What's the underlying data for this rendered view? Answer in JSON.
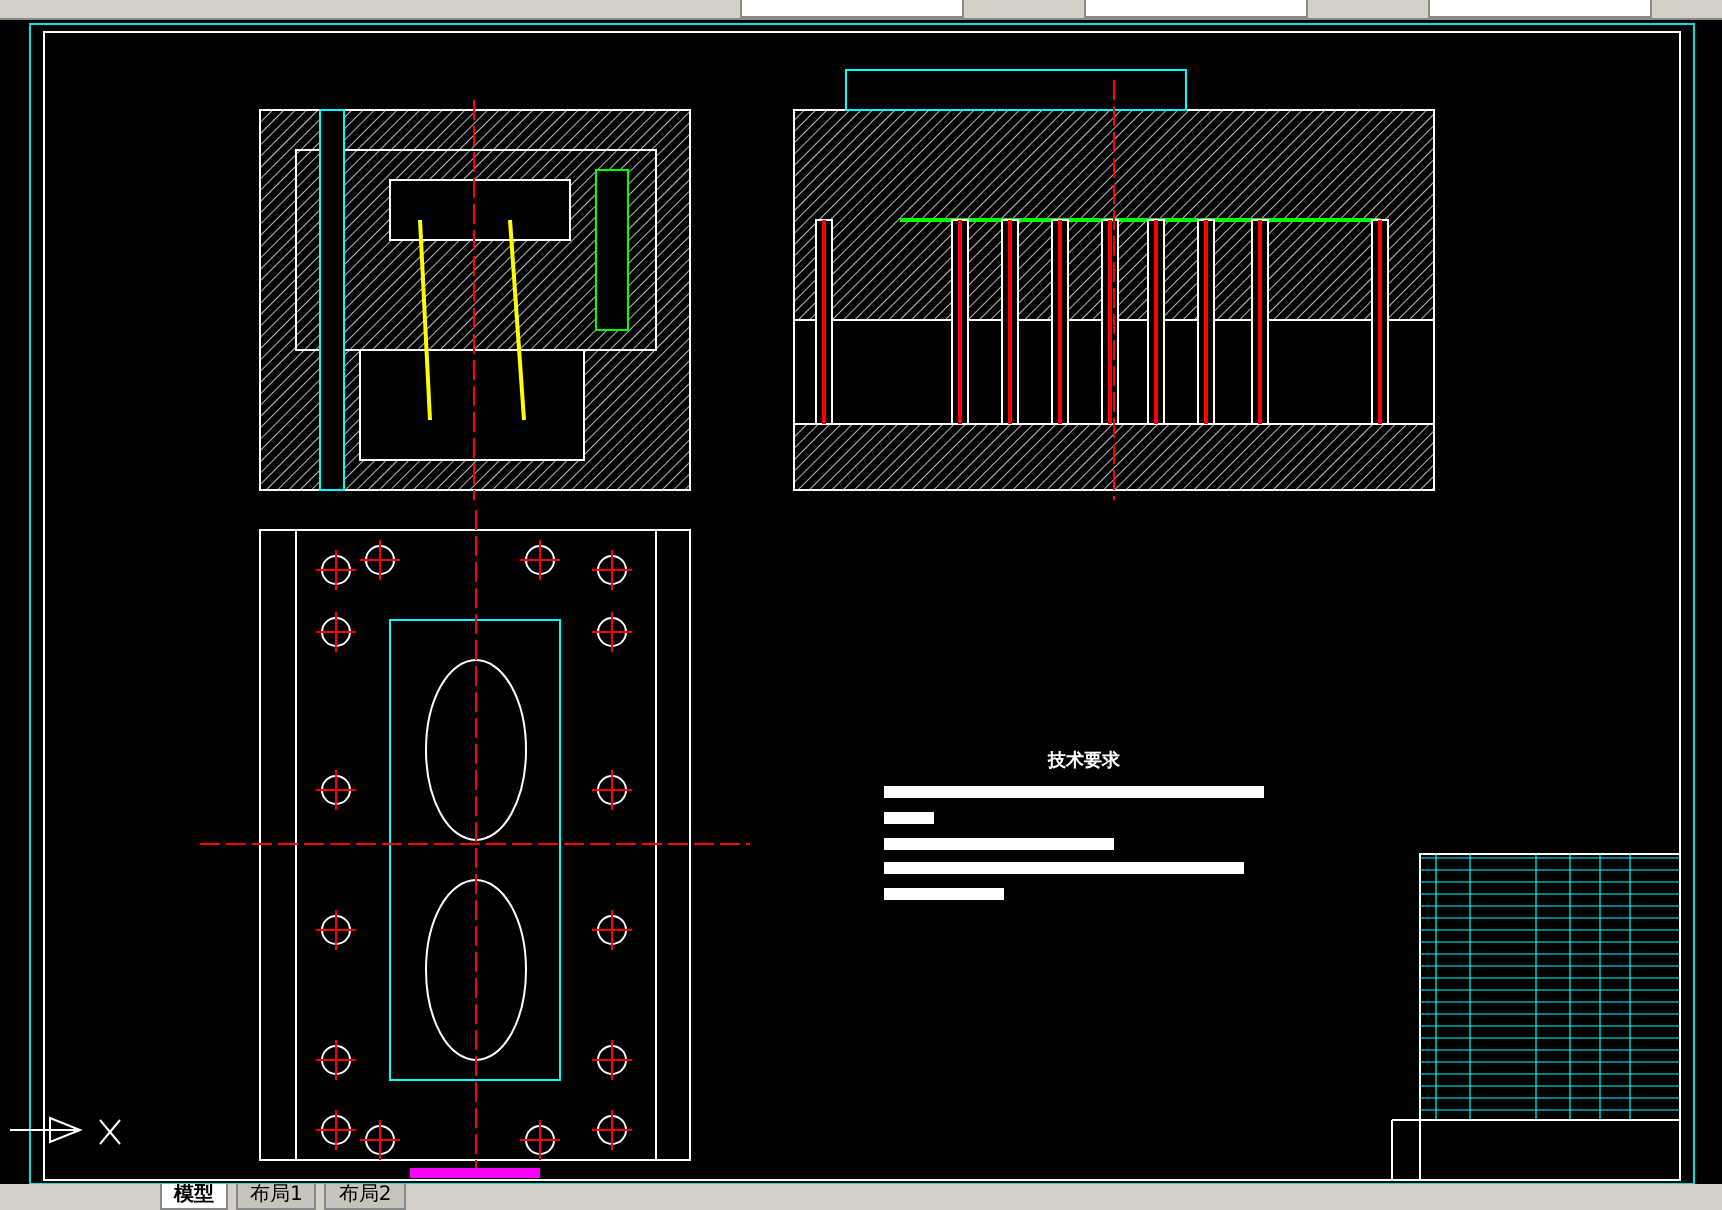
{
  "notes": {
    "title": "技术要求"
  },
  "layout_tabs": [
    {
      "label": "模型",
      "selected": true
    },
    {
      "label": "布局1",
      "selected": false
    },
    {
      "label": "布局2",
      "selected": false
    }
  ]
}
